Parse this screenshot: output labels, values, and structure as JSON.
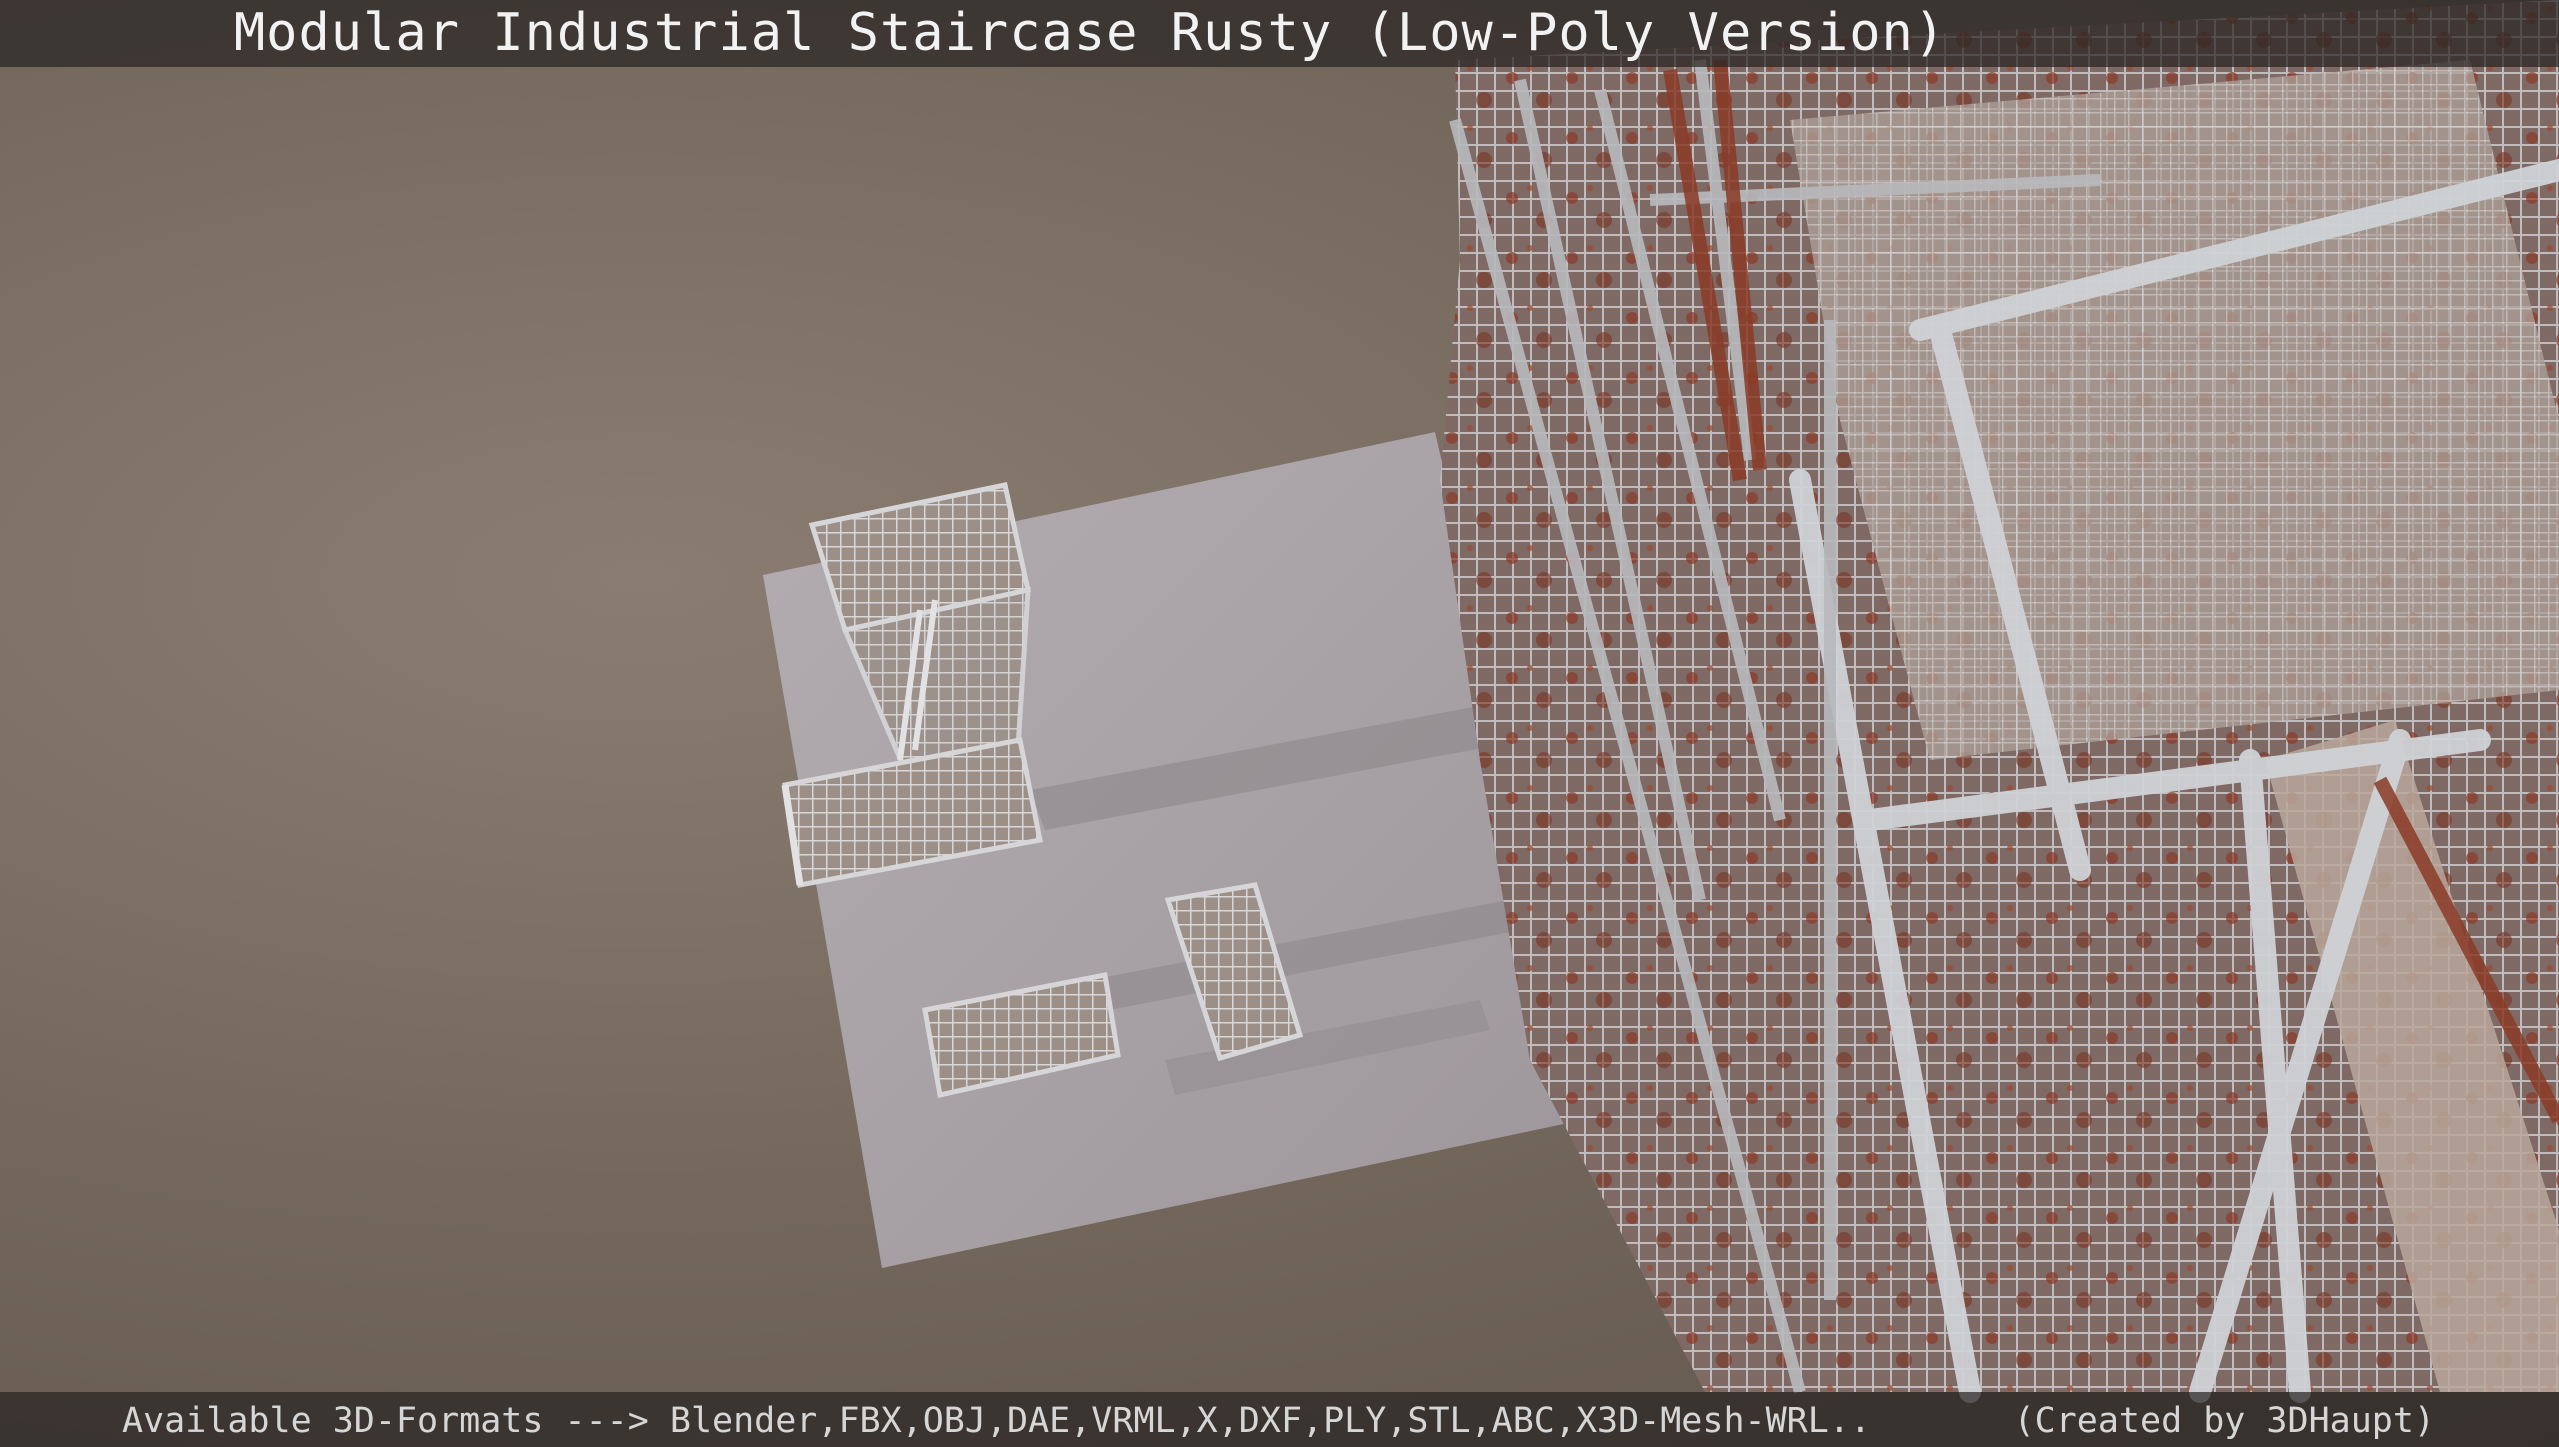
{
  "header": {
    "title": "Modular Industrial Staircase Rusty (Low-Poly Version)"
  },
  "footer": {
    "formats": "Available 3D-Formats ---> Blender,FBX,OBJ,DAE,VRML,X,DXF,PLY,STL,ABC,X3D-Mesh-WRL..",
    "credit": "(Created by 3DHaupt)"
  },
  "colors": {
    "background": "#766a5f",
    "plane": "#a9a2a6",
    "metal": "#b9bcc0",
    "rust": "#8a3b26",
    "bar": "#282422"
  }
}
